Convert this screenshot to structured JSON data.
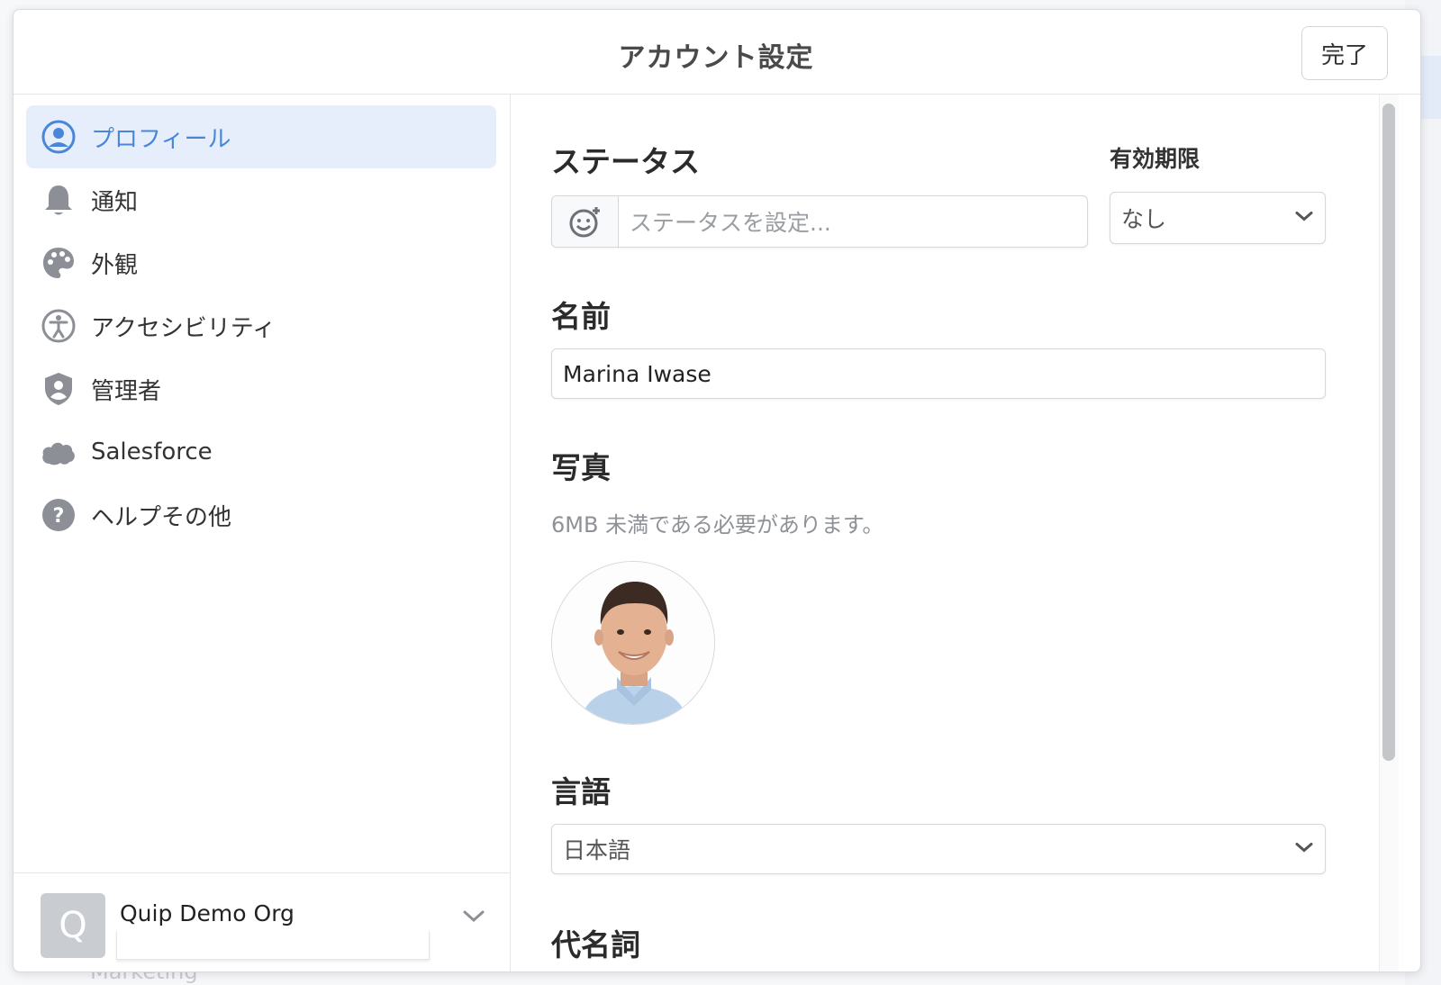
{
  "dialog": {
    "title": "アカウント設定",
    "done_label": "完了"
  },
  "sidebar": {
    "items": [
      {
        "label": "プロフィール",
        "icon": "profile-icon",
        "active": true
      },
      {
        "label": "通知",
        "icon": "bell-icon"
      },
      {
        "label": "外観",
        "icon": "palette-icon"
      },
      {
        "label": "アクセシビリティ",
        "icon": "accessibility-icon"
      },
      {
        "label": "管理者",
        "icon": "shield-icon"
      },
      {
        "label": "Salesforce",
        "icon": "cloud-icon"
      },
      {
        "label": "ヘルプその他",
        "icon": "help-icon"
      }
    ],
    "org": {
      "avatar_letter": "Q",
      "name": "Quip Demo Org"
    }
  },
  "profile": {
    "status": {
      "title": "ステータス",
      "placeholder": "ステータスを設定..."
    },
    "expiry": {
      "label": "有効期限",
      "value": "なし"
    },
    "name": {
      "title": "名前",
      "value": "Marina Iwase"
    },
    "photo": {
      "title": "写真",
      "hint": "6MB 未満である必要があります。"
    },
    "language": {
      "title": "言語",
      "value": "日本語"
    },
    "pronouns": {
      "title": "代名詞"
    }
  },
  "background": {
    "bottom_text": "Marketing"
  },
  "colors": {
    "accent": "#4a86d8",
    "active_bg": "#e6eefb",
    "icon_gray": "#8c9096"
  }
}
